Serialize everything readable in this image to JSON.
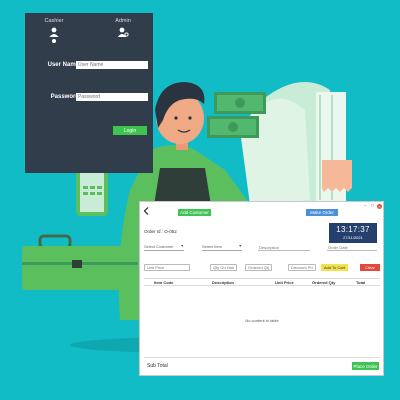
{
  "login": {
    "roles": [
      {
        "label": "Cashier",
        "icon": "user-icon"
      },
      {
        "label": "Admin",
        "icon": "admin-user-icon"
      }
    ],
    "username_label": "User Name",
    "username_placeholder": "User Name",
    "password_label": "Password",
    "password_placeholder": "Password",
    "login_button": "Login"
  },
  "order": {
    "add_customer": "Add Customer",
    "make_order": "Make Order",
    "window_controls": [
      "−",
      "□",
      "×"
    ],
    "clock_time": "13:17:37",
    "clock_date": "27/11/2021",
    "order_id": "Order Id : O-052",
    "select_customer": "Select Customer",
    "select_item": "Select Item",
    "description_placeholder": "Description",
    "order_date_placeholder": "Order Date",
    "unit_price_placeholder": "Unit Price",
    "qty_on_hand_placeholder": "Qty On Hand",
    "ordered_qty_placeholder": "Ordered Qty",
    "discount_placeholder": "Discount Price",
    "add_to_cart": "Add To Cart",
    "clear": "Clear",
    "columns": [
      "Item Code",
      "Description",
      "Unit Price",
      "Ordered Qty",
      "Total"
    ],
    "empty_text": "No content in table",
    "sub_total": "Sub Total",
    "place_order": "Place Order"
  },
  "colors": {
    "background": "#12bcc6",
    "login_panel": "#323d4c",
    "accent_green": "#3fc454",
    "accent_blue": "#4a8fdc",
    "clock_bg": "#26406e",
    "clear_red": "#e4473b",
    "cart_yellow": "#f2e24c"
  }
}
